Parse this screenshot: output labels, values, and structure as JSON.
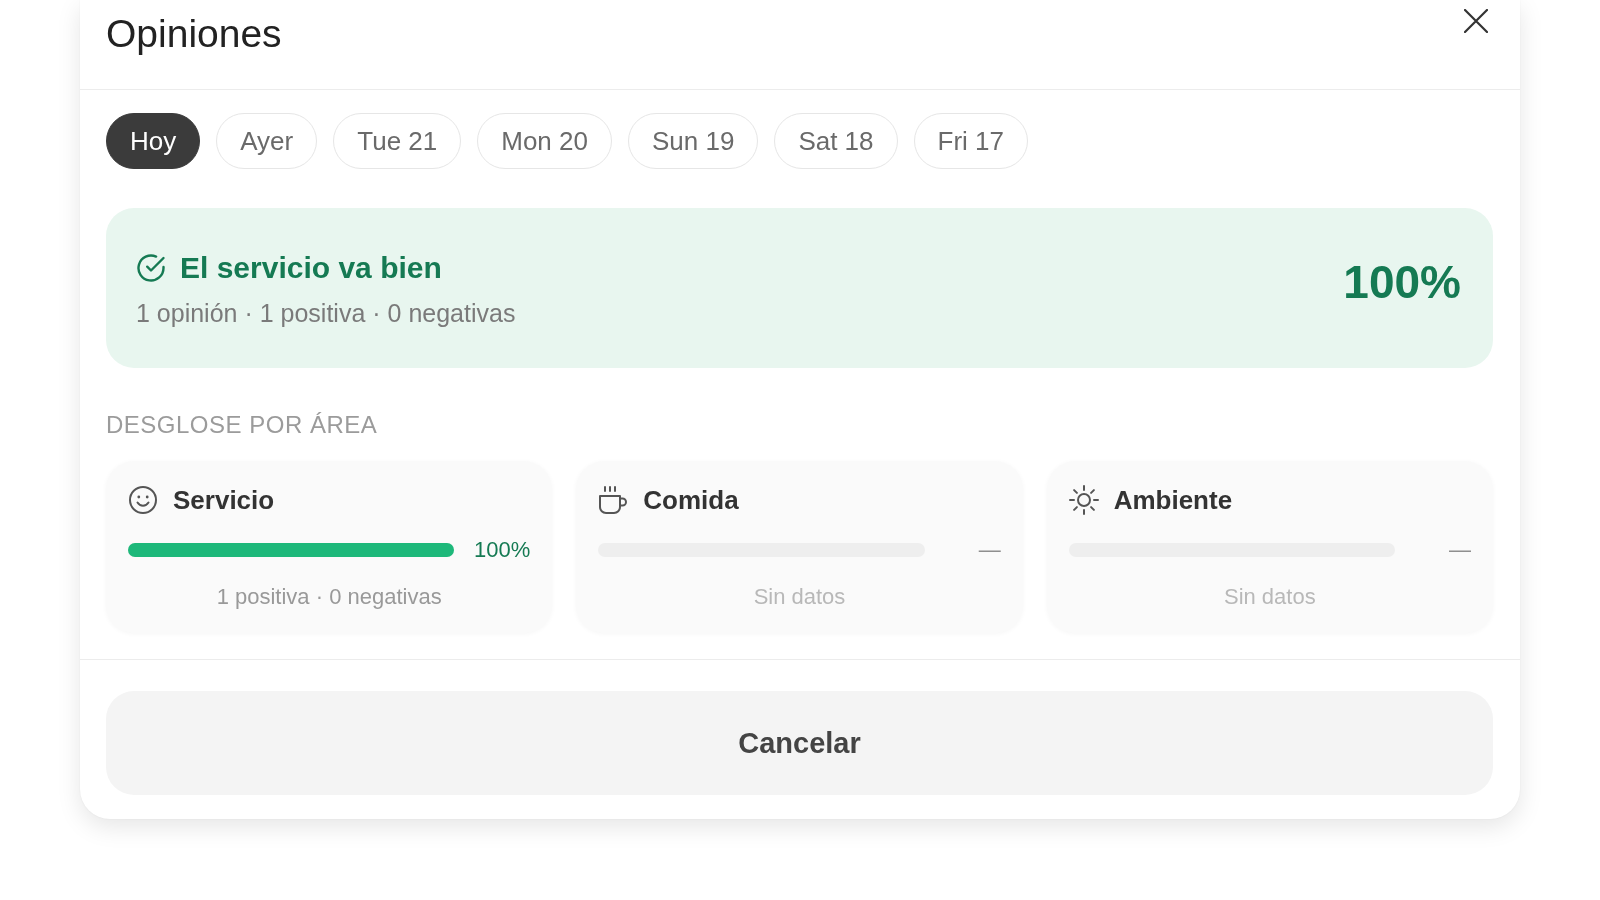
{
  "dialog": {
    "title": "Opiniones"
  },
  "day_tabs": [
    {
      "label": "Hoy",
      "selected": true
    },
    {
      "label": "Ayer",
      "selected": false
    },
    {
      "label": "Tue 21",
      "selected": false
    },
    {
      "label": "Mon 20",
      "selected": false
    },
    {
      "label": "Sun 19",
      "selected": false
    },
    {
      "label": "Sat 18",
      "selected": false
    },
    {
      "label": "Fri 17",
      "selected": false
    }
  ],
  "summary": {
    "positive": true,
    "title": "El servicio va bien",
    "detail": "1 opinión · 1 positiva · 0 negativas",
    "score": "100%"
  },
  "breakdown": {
    "heading": "DESGLOSE POR ÁREA",
    "areas": [
      {
        "name": "Servicio",
        "has_data": true,
        "level": 1,
        "reading": "100%",
        "caption": "1 positiva · 0 negativas"
      },
      {
        "name": "Comida",
        "has_data": false,
        "reading": "—",
        "caption": "Sin datos"
      },
      {
        "name": "Ambiente",
        "has_data": false,
        "reading": "—",
        "caption": "Sin datos"
      }
    ]
  },
  "footer": {
    "cancel_button": "Cancelar"
  }
}
